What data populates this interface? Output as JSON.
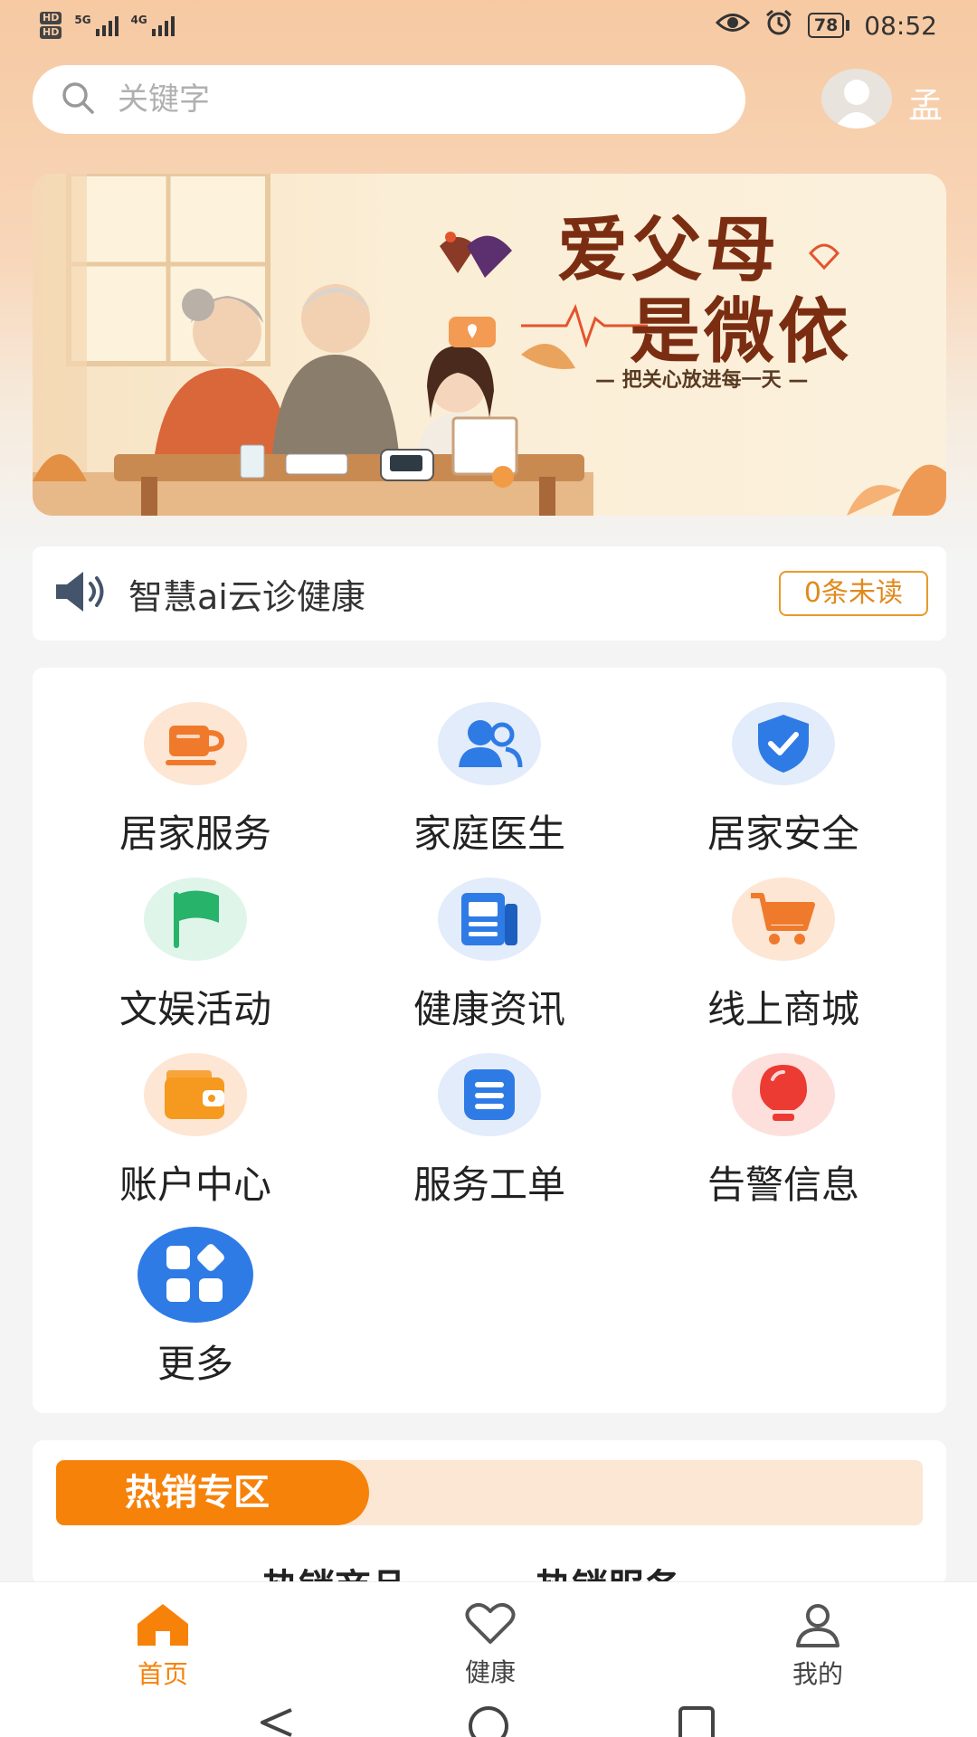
{
  "status_bar": {
    "hd1": "HD",
    "hd2": "HD",
    "sig1_label": "5G",
    "sig2_label": "4G",
    "battery": "78",
    "time": "08:52"
  },
  "search": {
    "placeholder": "关键字",
    "value": ""
  },
  "user": {
    "name": "孟"
  },
  "banner": {
    "title_line1": "爱父母",
    "title_line2": "是微依",
    "subtitle": "— 把关心放进每一天 —"
  },
  "notice": {
    "text": "智慧ai云诊健康",
    "badge": "0条未读"
  },
  "grid": {
    "items": [
      {
        "label": "居家服务",
        "icon": "teacup-icon"
      },
      {
        "label": "家庭医生",
        "icon": "people-icon"
      },
      {
        "label": "居家安全",
        "icon": "shield-check-icon"
      },
      {
        "label": "文娱活动",
        "icon": "flag-icon"
      },
      {
        "label": "健康资讯",
        "icon": "news-icon"
      },
      {
        "label": "线上商城",
        "icon": "shopping-cart-icon"
      },
      {
        "label": "账户中心",
        "icon": "wallet-icon"
      },
      {
        "label": "服务工单",
        "icon": "list-icon"
      },
      {
        "label": "告警信息",
        "icon": "alarm-bulb-icon"
      },
      {
        "label": "更多",
        "icon": "apps-icon"
      }
    ]
  },
  "hot": {
    "title": "热销专区",
    "tabs": [
      "热销商品",
      "热销服务"
    ]
  },
  "bottom_nav": {
    "items": [
      {
        "label": "首页",
        "icon": "home-icon",
        "active": true
      },
      {
        "label": "健康",
        "icon": "heart-icon",
        "active": false
      },
      {
        "label": "我的",
        "icon": "user-icon",
        "active": false
      }
    ]
  },
  "colors": {
    "accent": "#f7820a",
    "header_bg": "#f6c9a2",
    "badge_border": "#e89a2c"
  }
}
